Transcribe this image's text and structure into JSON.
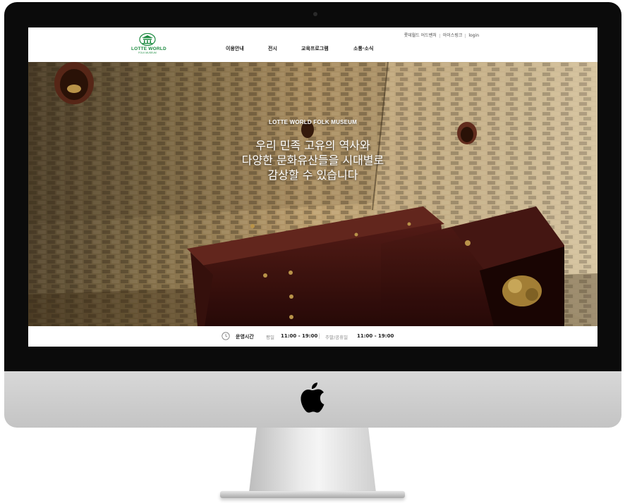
{
  "site": {
    "logo_main": "LOTTE WORLD",
    "logo_sub": "FOLK MUSEUM"
  },
  "utility_nav": [
    {
      "label": "롯데월드 어드벤처"
    },
    {
      "label": "아이스링크"
    },
    {
      "label": "login"
    }
  ],
  "main_nav": [
    {
      "label": "이용안내"
    },
    {
      "label": "전시"
    },
    {
      "label": "교육프로그램"
    },
    {
      "label": "소통·소식"
    }
  ],
  "hero": {
    "kicker": "LOTTE WORLD FOLK MUSEUM",
    "title_lines": [
      "우리 민족 고유의 역사와",
      "다양한 문화유산들을 시대별로",
      "감상할 수 있습니다"
    ]
  },
  "hours": {
    "label": "운영시간",
    "weekday_label": "평일",
    "weekday_time": "11:00 - 19:00",
    "weekend_label": "주말/공휴일",
    "weekend_time": "11:00 - 19:00"
  },
  "colors": {
    "brand_green": "#1b8a3f",
    "bezel": "#0b0b0b"
  },
  "icons": [
    "clock-icon",
    "apple-logo-icon"
  ]
}
